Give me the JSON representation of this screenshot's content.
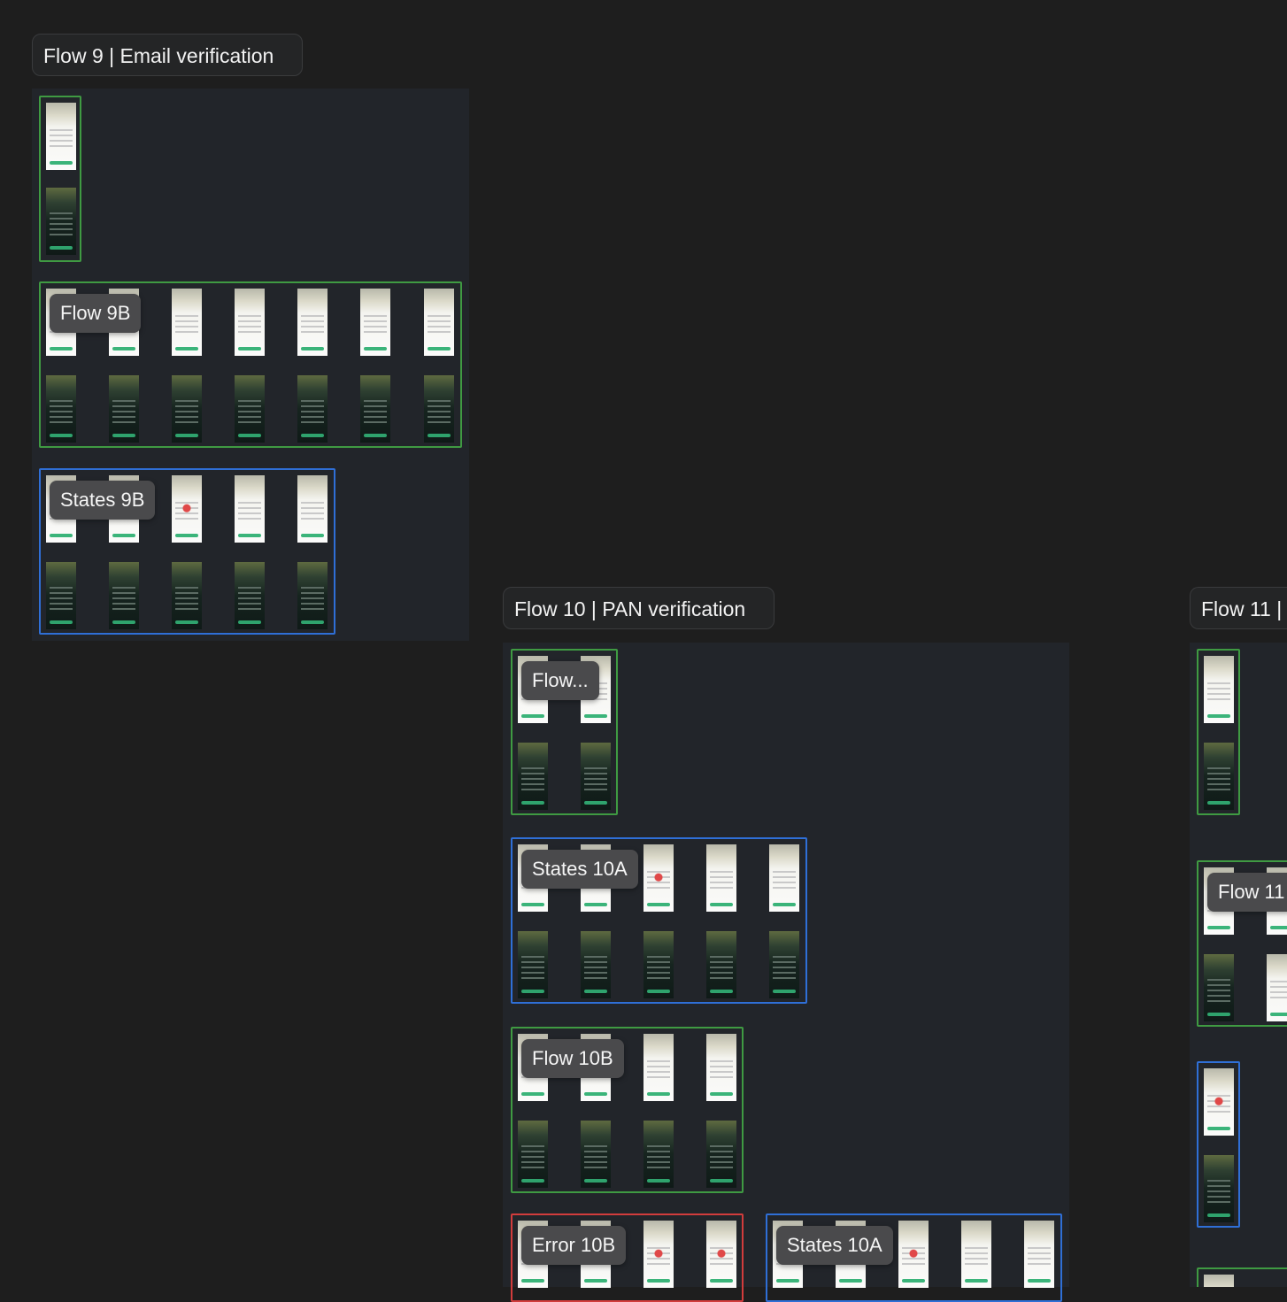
{
  "sections": {
    "flow9": {
      "title": "Flow 9 | Email verification"
    },
    "flow10": {
      "title": "Flow 10 | PAN verification"
    },
    "flow11": {
      "title": "Flow 11 |"
    }
  },
  "chips": {
    "flow9b": "Flow 9B",
    "states9b": "States 9B",
    "flow10a": "Flow...",
    "states10a": "States 10A",
    "flow10b": "Flow 10B",
    "error10b": "Error 10B",
    "states10a_second": "States 10A",
    "flow11b": "Flow 11"
  }
}
